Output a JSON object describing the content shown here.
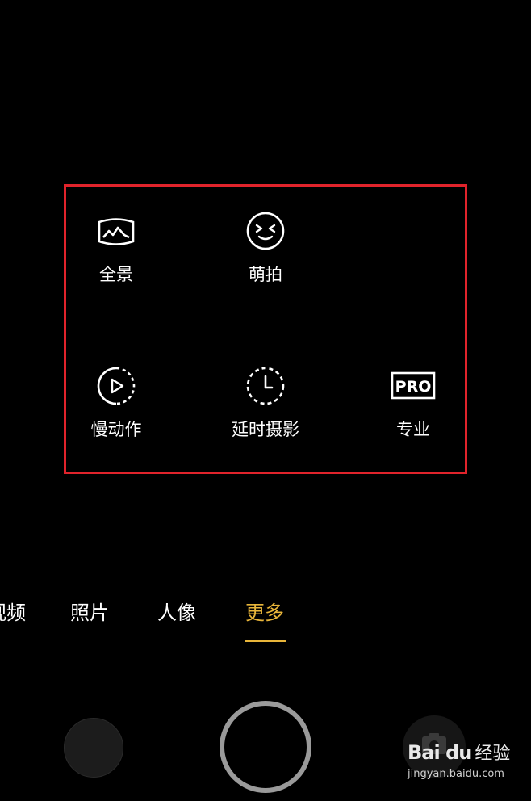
{
  "modes": [
    {
      "name": "panorama",
      "label": "全景",
      "icon": "panorama-icon"
    },
    {
      "name": "cute-shot",
      "label": "萌拍",
      "icon": "smile-face-icon"
    },
    {
      "name": "slow-motion",
      "label": "慢动作",
      "icon": "slow-motion-play-icon"
    },
    {
      "name": "time-lapse",
      "label": "延时摄影",
      "icon": "time-lapse-clock-icon"
    },
    {
      "name": "pro",
      "label": "专业",
      "icon": "pro-badge-icon",
      "badge_text": "PRO"
    }
  ],
  "tabs": [
    {
      "label": "视频",
      "active": false
    },
    {
      "label": "照片",
      "active": false
    },
    {
      "label": "人像",
      "active": false
    },
    {
      "label": "更多",
      "active": true
    }
  ],
  "colors": {
    "accent": "#e8b53a",
    "highlight_border": "#e0232b",
    "background": "#000000",
    "shutter_ring": "#9a9a9a"
  },
  "watermark": {
    "logo": "Bai du",
    "cn": "经验",
    "url": "jingyan.baidu.com"
  }
}
